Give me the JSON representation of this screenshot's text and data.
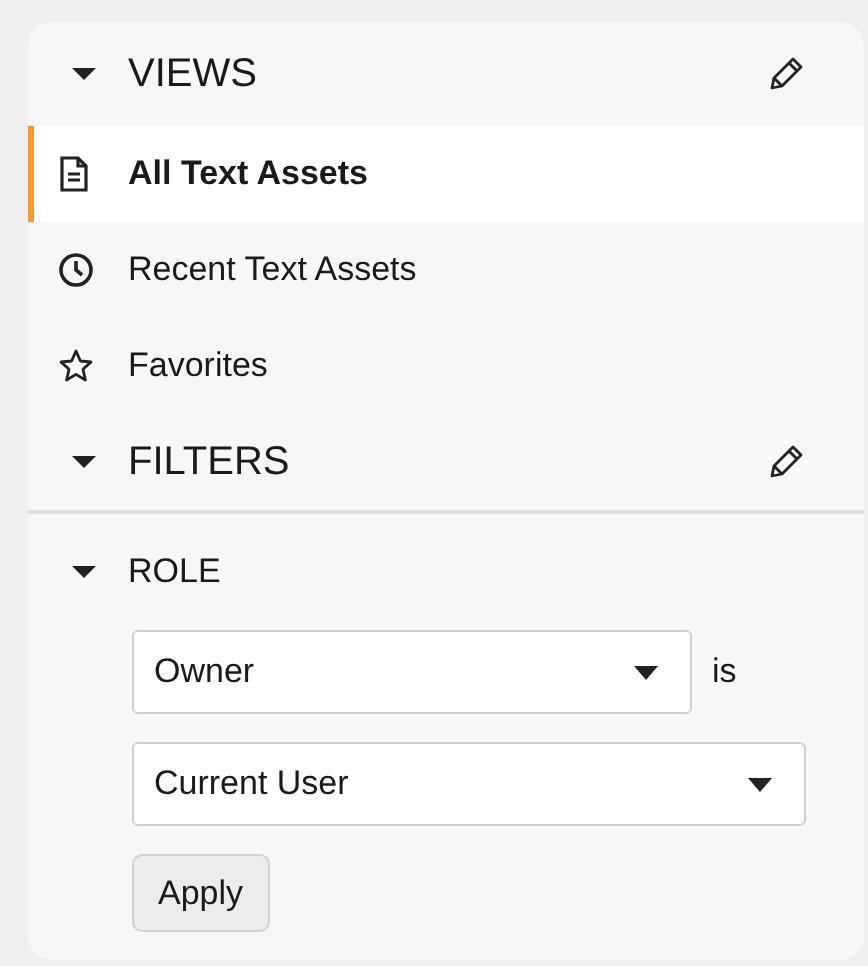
{
  "views": {
    "title": "VIEWS",
    "expanded": true,
    "items": [
      {
        "label": "All Text Assets",
        "selected": true
      },
      {
        "label": "Recent Text Assets",
        "selected": false
      },
      {
        "label": "Favorites",
        "selected": false
      }
    ]
  },
  "filters": {
    "title": "FILTERS",
    "expanded": true,
    "groups": [
      {
        "title": "ROLE",
        "expanded": true,
        "field": "Owner",
        "operator": "is",
        "value": "Current User",
        "apply": "Apply"
      }
    ]
  }
}
